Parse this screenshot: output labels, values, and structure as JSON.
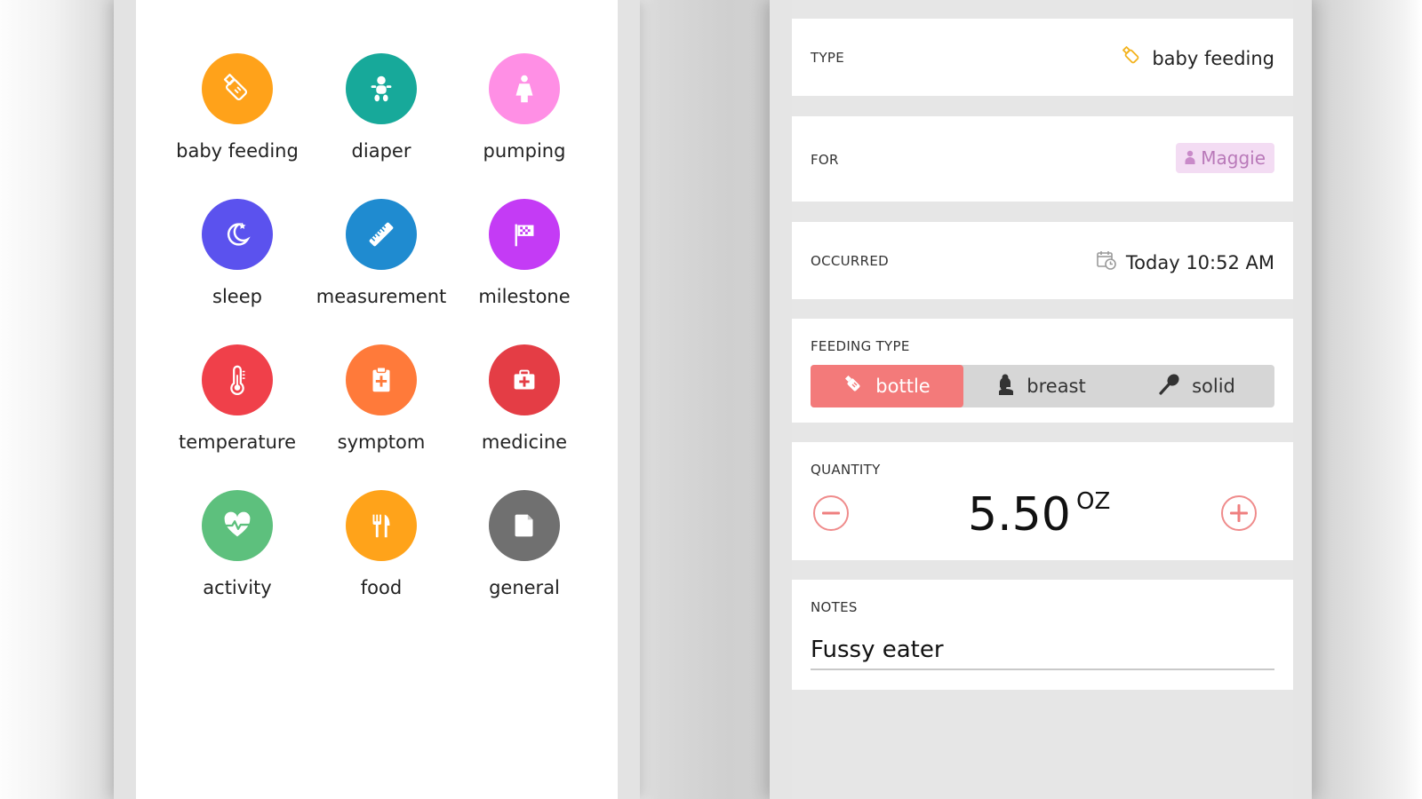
{
  "categories": [
    {
      "label": "baby feeding",
      "icon": "bottle-icon",
      "color": "#FFA21A"
    },
    {
      "label": "diaper",
      "icon": "baby-icon",
      "color": "#17A99A"
    },
    {
      "label": "pumping",
      "icon": "pumping-icon",
      "color": "#FF8FE5"
    },
    {
      "label": "sleep",
      "icon": "moon-icon",
      "color": "#5B52EE"
    },
    {
      "label": "measurement",
      "icon": "ruler-icon",
      "color": "#1F8BD0"
    },
    {
      "label": "milestone",
      "icon": "flag-icon",
      "color": "#C43BF5"
    },
    {
      "label": "temperature",
      "icon": "thermometer-icon",
      "color": "#F0404A"
    },
    {
      "label": "symptom",
      "icon": "clipboard-icon",
      "color": "#FF7A3A"
    },
    {
      "label": "medicine",
      "icon": "medkit-icon",
      "color": "#E43D45"
    },
    {
      "label": "activity",
      "icon": "heartbeat-icon",
      "color": "#5DC07D"
    },
    {
      "label": "food",
      "icon": "utensils-icon",
      "color": "#FFA31A"
    },
    {
      "label": "general",
      "icon": "file-icon",
      "color": "#707070"
    }
  ],
  "form": {
    "type": {
      "label": "TYPE",
      "value": "baby feeding",
      "icon": "bottle-icon"
    },
    "for": {
      "label": "FOR",
      "value": "Maggie",
      "icon": "person-icon"
    },
    "occurred": {
      "label": "OCCURRED",
      "value": "Today 10:52 AM",
      "icon": "calendar-clock-icon"
    },
    "feeding_type": {
      "label": "FEEDING TYPE",
      "options": [
        {
          "label": "bottle",
          "icon": "bottle-icon"
        },
        {
          "label": "breast",
          "icon": "nursing-icon"
        },
        {
          "label": "solid",
          "icon": "spoon-icon"
        }
      ],
      "selected": "bottle"
    },
    "quantity": {
      "label": "QUANTITY",
      "value": "5.50",
      "unit": "OZ"
    },
    "notes": {
      "label": "NOTES",
      "value": "Fussy eater"
    }
  },
  "colors": {
    "accent": "#F37A7A",
    "pill_bg": "#F3DCF3",
    "pill_text": "#B979B9",
    "type_icon": "#F3B21A"
  }
}
